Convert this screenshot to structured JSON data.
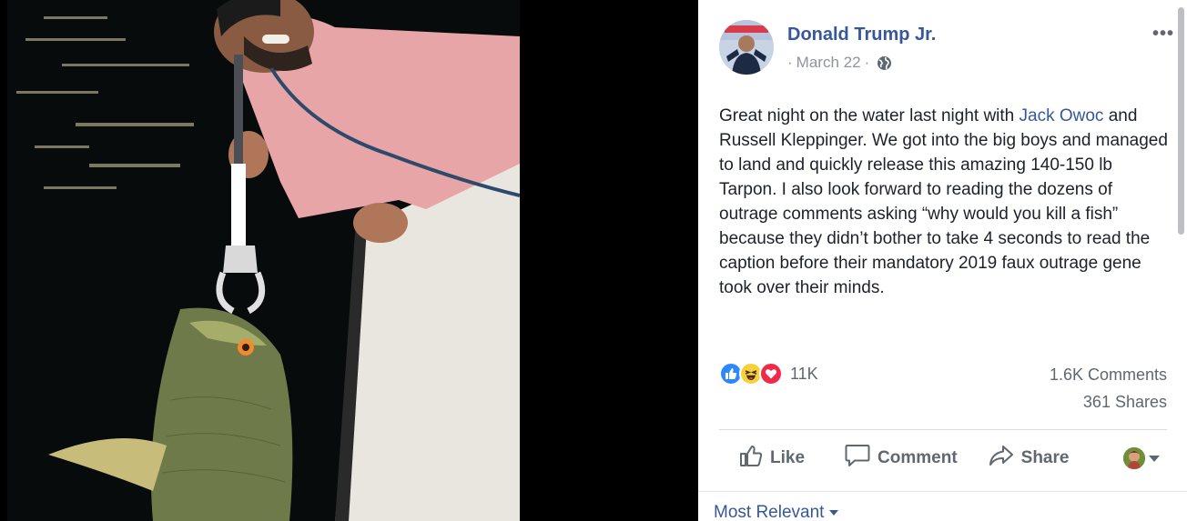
{
  "post": {
    "author": "Donald Trump Jr.",
    "date": "March 22",
    "date_separator": "·",
    "audience_icon": "globe-icon",
    "more_label": "•••",
    "text_before": "Great night on the water last night with ",
    "tagged_person": "Jack Owoc",
    "text_after": " and Russell Kleppinger. We got into the big boys and managed to land and quickly release this amazing 140-150 lb Tarpon. I also look forward to reading the dozens of outrage comments asking “why would you kill a fish” because they didn’t bother to take 4 seconds to read the caption before their mandatory 2019 faux outrage gene took over their minds."
  },
  "stats": {
    "reactions_count": "11K",
    "reaction_icons": [
      "like-reaction-icon",
      "haha-reaction-icon",
      "love-reaction-icon"
    ],
    "comments": "1.6K Comments",
    "shares": "361 Shares"
  },
  "actions": {
    "like": "Like",
    "comment": "Comment",
    "share": "Share"
  },
  "comments_sort": {
    "label": "Most Relevant"
  },
  "colors": {
    "link": "#365899",
    "muted": "#606770",
    "like_blue": "#2d88ff",
    "love_red": "#f0284a",
    "haha_yellow": "#f7d13b"
  }
}
